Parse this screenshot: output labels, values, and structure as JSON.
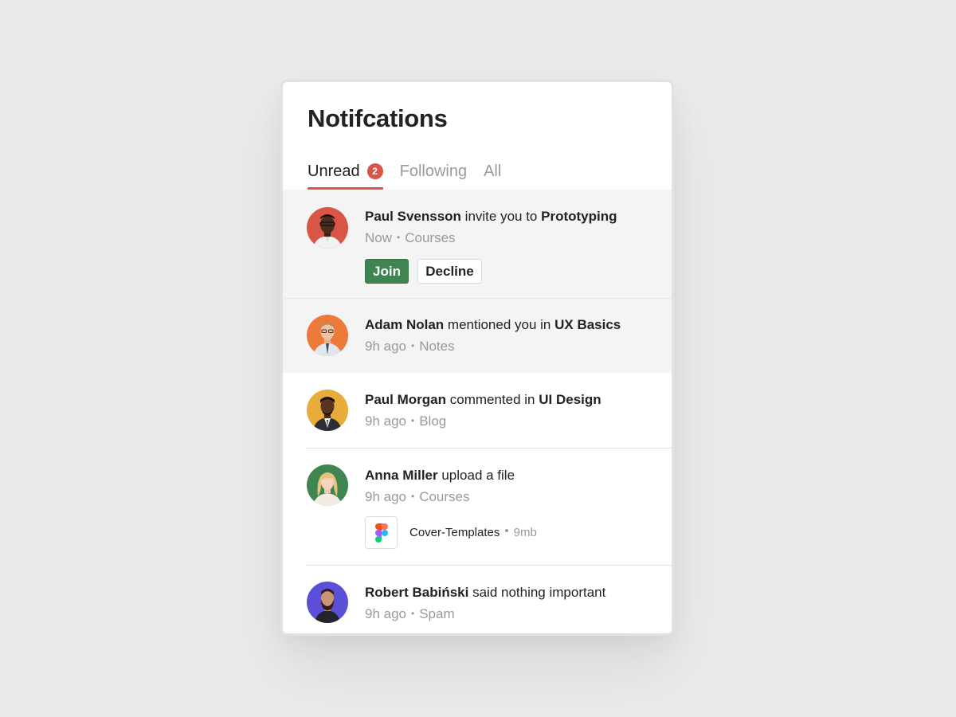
{
  "header": {
    "title": "Notifcations"
  },
  "tabs": [
    {
      "label": "Unread",
      "badge": "2",
      "active": true
    },
    {
      "label": "Following"
    },
    {
      "label": "All"
    }
  ],
  "accent_color": "#d95545",
  "notifications": [
    {
      "actor": "Paul Svensson",
      "action": " invite you to ",
      "target": "Prototyping",
      "time": "Now",
      "category": "Courses",
      "unread": true,
      "avatar_bg": "#d95545",
      "buttons": {
        "join": "Join",
        "decline": "Decline"
      }
    },
    {
      "actor": "Adam Nolan",
      "action": " mentioned you in ",
      "target": "UX Basics",
      "time": "9h ago",
      "category": "Notes",
      "unread": true,
      "avatar_bg": "#ee7a3a"
    },
    {
      "actor": "Paul Morgan",
      "action": " commented in ",
      "target": "UI Design",
      "time": "9h ago",
      "category": "Blog",
      "unread": false,
      "avatar_bg": "#e8ac3a"
    },
    {
      "actor": "Anna Miller",
      "action": " upload a file",
      "target": "",
      "time": "9h ago",
      "category": "Courses",
      "unread": false,
      "avatar_bg": "#3e8552",
      "file": {
        "name": "Cover-Templates",
        "size": "9mb",
        "icon": "figma-icon"
      }
    },
    {
      "actor": "Robert Babiński",
      "action": " said nothing important",
      "target": "",
      "time": "9h ago",
      "category": "Spam",
      "unread": false,
      "avatar_bg": "#5b4fd8"
    }
  ]
}
